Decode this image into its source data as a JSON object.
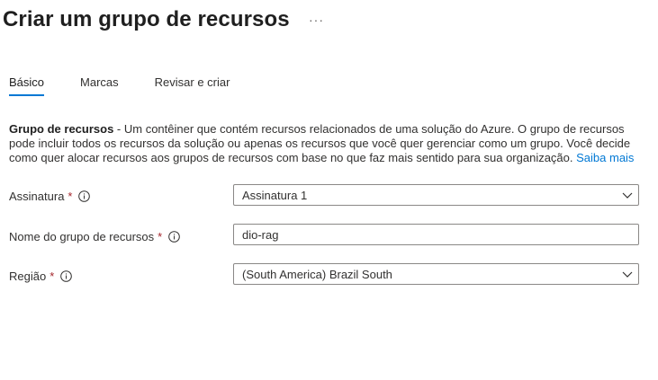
{
  "header": {
    "title": "Criar um grupo de recursos",
    "more_label": "···"
  },
  "tabs": [
    {
      "label": "Básico",
      "active": true
    },
    {
      "label": "Marcas",
      "active": false
    },
    {
      "label": "Revisar e criar",
      "active": false
    }
  ],
  "description": {
    "heading": "Grupo de recursos",
    "body": " - Um contêiner que contém recursos relacionados de uma solução do Azure. O grupo de recursos pode incluir todos os recursos da solução ou apenas os recursos que você quer gerenciar como um grupo. Você decide como quer alocar recursos aos grupos de recursos com base no que faz mais sentido para sua organização. ",
    "link": "Saiba mais"
  },
  "form": {
    "subscription": {
      "label": "Assinatura",
      "required_mark": "*",
      "value": "Assinatura 1"
    },
    "resource_group_name": {
      "label": "Nome do grupo de recursos",
      "required_mark": "*",
      "value": "dio-rag"
    },
    "region": {
      "label": "Região",
      "required_mark": "*",
      "value": "(South America) Brazil South"
    }
  },
  "colors": {
    "accent": "#0078d4",
    "required": "#a4262c",
    "border": "#8a8886"
  }
}
